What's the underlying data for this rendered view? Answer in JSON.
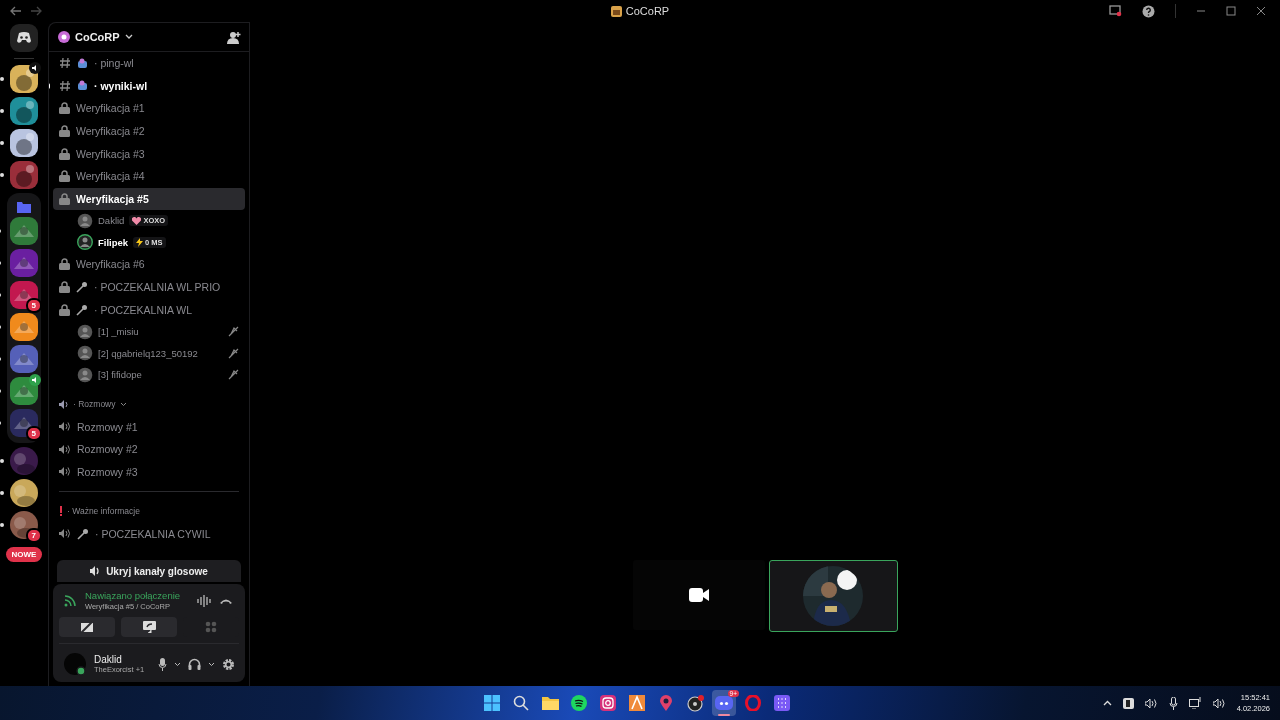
{
  "window": {
    "title": "CoCoRP"
  },
  "server_rail": {
    "servers": [
      {
        "color": "#d9b25a",
        "speaking": true
      },
      {
        "color": "#1f8f9a"
      },
      {
        "color": "#b9c4e0"
      },
      {
        "color": "#9a2e3a"
      }
    ],
    "folder": {
      "servers": [
        {
          "color": "#2f7a3a"
        },
        {
          "color": "#6a1fa0"
        },
        {
          "color": "#c2184f",
          "badge": "5"
        },
        {
          "color": "#f08a1c"
        },
        {
          "color": "#5560b8"
        },
        {
          "color": "#2e8b3e",
          "speaking": true
        },
        {
          "color": "#2a2a5e",
          "badge": "5"
        }
      ]
    },
    "servers_after": [
      {
        "color": "#3a1a4a"
      },
      {
        "color": "#c9a85a"
      },
      {
        "color": "#8a5a4a",
        "badge": "7"
      }
    ],
    "new_badge": "NOWE"
  },
  "server": {
    "name": "CoCoRP"
  },
  "channels": [
    {
      "kind": "text",
      "name": "· ping-wl",
      "unread": false,
      "selected": false
    },
    {
      "kind": "text",
      "name": "· wyniki-wl",
      "unread": true,
      "selected": false
    },
    {
      "kind": "locked",
      "name": "Weryfikacja #1",
      "selected": false
    },
    {
      "kind": "locked",
      "name": "Weryfikacja #2",
      "selected": false
    },
    {
      "kind": "locked",
      "name": "Weryfikacja #3",
      "selected": false
    },
    {
      "kind": "locked",
      "name": "Weryfikacja #4",
      "selected": false
    },
    {
      "kind": "locked",
      "name": "Weryfikacja #5",
      "selected": true,
      "members": [
        {
          "name": "Daklid",
          "tag": "XOXO",
          "speaking": false,
          "muted": false
        },
        {
          "name": "Filipek",
          "tag": "0 MS",
          "speaking": true,
          "muted": false
        }
      ]
    },
    {
      "kind": "locked",
      "name": "Weryfikacja #6",
      "selected": false
    },
    {
      "kind": "locked-mic",
      "name": "· POCZEKALNIA WL PRIO",
      "selected": false
    },
    {
      "kind": "locked-mic",
      "name": "· POCZEKALNIA WL",
      "selected": false,
      "members": [
        {
          "name": "[1] _misiu",
          "speaking": false,
          "muted": true
        },
        {
          "name": "[2] qgabrielq123_50192",
          "speaking": false,
          "muted": true
        },
        {
          "name": "[3] fifidope",
          "speaking": false,
          "muted": true
        }
      ]
    },
    {
      "kind": "category-voice",
      "name": "· Rozmowy"
    },
    {
      "kind": "voice",
      "name": "Rozmowy #1",
      "selected": false
    },
    {
      "kind": "voice",
      "name": "Rozmowy #2",
      "selected": false
    },
    {
      "kind": "voice",
      "name": "Rozmowy #3",
      "selected": false
    },
    {
      "kind": "divider"
    },
    {
      "kind": "category-alert",
      "name": "· Ważne informacje"
    },
    {
      "kind": "voice-mic",
      "name": "· POCZEKALNIA CYWIL",
      "selected": false
    }
  ],
  "hide_voice_button": "Ukryj kanały glosowe",
  "voice_panel": {
    "status": "Nawiązano połączenie",
    "location": "Weryfikacja #5 / CoCoRP",
    "buttons": [
      {
        "kind": "camera-off",
        "disabled": false
      },
      {
        "kind": "screen-share",
        "disabled": false
      },
      {
        "kind": "activities",
        "disabled": true
      }
    ]
  },
  "user_panel": {
    "name": "Daklid",
    "activity": "TheExorcist +1"
  },
  "taskbar": {
    "apps": [
      {
        "kind": "start",
        "active": false
      },
      {
        "kind": "search",
        "active": false
      },
      {
        "kind": "folder",
        "active": false
      },
      {
        "kind": "spotify",
        "active": false
      },
      {
        "kind": "instagram",
        "active": false
      },
      {
        "kind": "app",
        "active": false
      },
      {
        "kind": "pin",
        "active": false
      },
      {
        "kind": "obs",
        "active": false
      },
      {
        "kind": "discord",
        "active": true,
        "badge": "9+"
      },
      {
        "kind": "opera",
        "active": false
      },
      {
        "kind": "grid",
        "active": false
      }
    ],
    "time": "15:52:41",
    "date": "4.02.2026"
  }
}
